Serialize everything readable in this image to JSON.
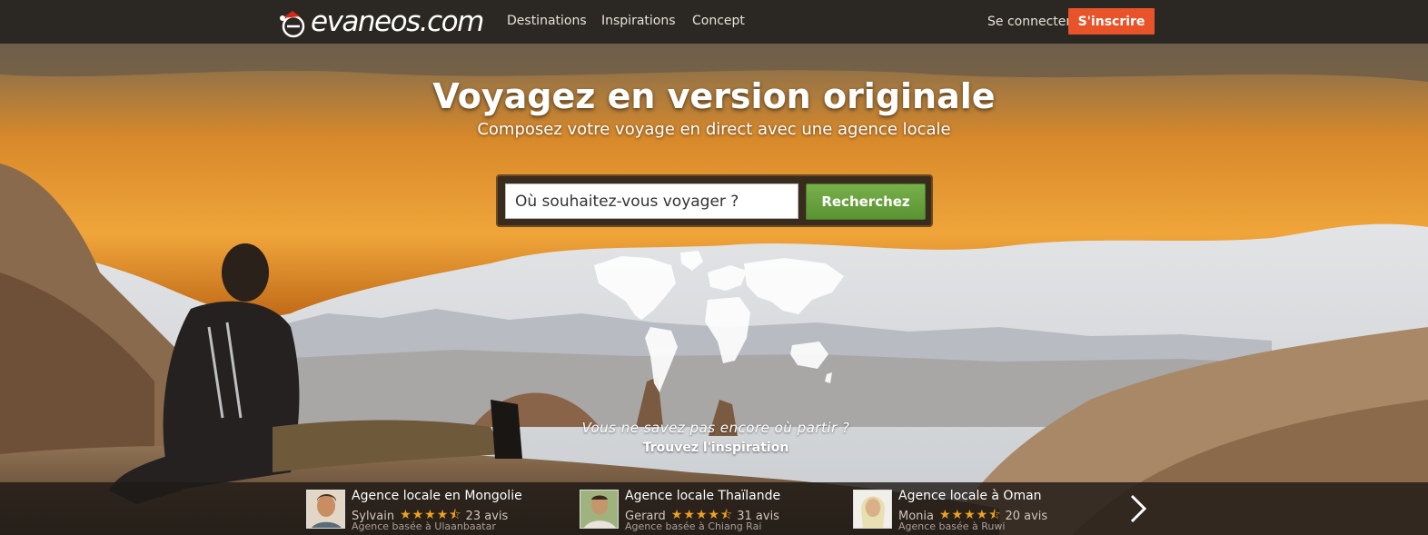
{
  "header": {
    "logo_text": "evaneos.com",
    "nav": [
      {
        "label": "Destinations"
      },
      {
        "label": "Inspirations"
      },
      {
        "label": "Concept"
      }
    ],
    "signin_label": "Se connecter",
    "signup_label": "S'inscrire"
  },
  "hero": {
    "title": "Voyagez en version originale",
    "subtitle": "Composez votre voyage en direct avec une agence locale",
    "search": {
      "placeholder": "Où souhaitez-vous voyager ?",
      "button_label": "Recherchez"
    },
    "inspiration_question": "Vous ne savez pas encore où partir ?",
    "inspiration_link": "Trouvez l'inspiration"
  },
  "agencies": [
    {
      "title": "Agence locale en Mongolie",
      "agent": "Sylvain",
      "rating": 4.5,
      "reviews": "23 avis",
      "base": "Agence basée à Ulaanbaatar"
    },
    {
      "title": "Agence locale Thaïlande",
      "agent": "Gerard",
      "rating": 4.5,
      "reviews": "31 avis",
      "base": "Agence basée à Chiang Rai"
    },
    {
      "title": "Agence locale à Oman",
      "agent": "Monia",
      "rating": 4.5,
      "reviews": "20 avis",
      "base": "Agence basée à Ruwi"
    }
  ],
  "colors": {
    "topbar": "#2b2722",
    "signup": "#e8532a",
    "search_button": "#5a9332",
    "stars": "#f0a21c"
  },
  "icons": {
    "next": "chevron-right-icon",
    "stars": "star-rating-icon",
    "map": "world-map-icon"
  }
}
